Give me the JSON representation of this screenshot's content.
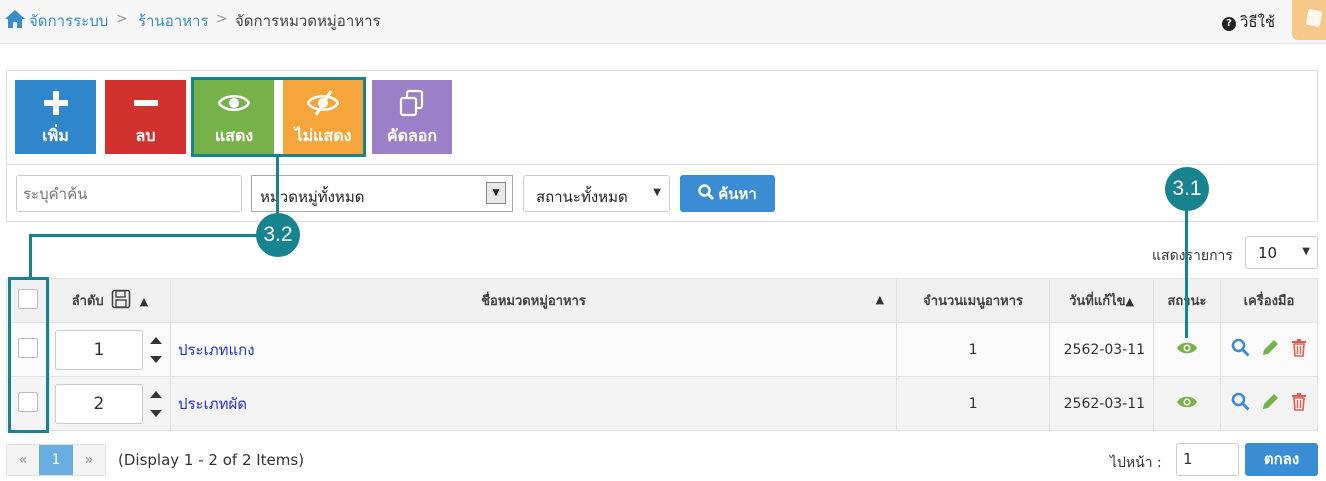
{
  "breadcrumb": {
    "items": [
      "จัดการระบบ",
      "ร้านอาหาร",
      "จัดการหมวดหมู่อาหาร"
    ],
    "separator": ">"
  },
  "help": {
    "icon": "question-icon",
    "label": "วิธีใช้"
  },
  "toolbar": {
    "add_label": "เพิ่ม",
    "delete_label": "ลบ",
    "show_label": "แสดง",
    "hide_label": "ไม่แสดง",
    "copy_label": "คัดลอก"
  },
  "filters": {
    "search_placeholder": "ระบุคำค้น",
    "category_value": "หมวดหมู่ทั้งหมด",
    "status_value": "สถานะทั้งหมด",
    "search_button": "ค้นหา"
  },
  "callouts": {
    "status": "3.1",
    "toggle": "3.2"
  },
  "per_page": {
    "label": "แสดงรายการ",
    "value": "10"
  },
  "table": {
    "headers": {
      "order": "ลำดับ",
      "name": "ชื่อหมวดหมู่อาหาร",
      "menu_count": "จำนวนเมนูอาหาร",
      "updated": "วันที่แก้ไข",
      "status": "สถานะ",
      "tools": "เครื่องมือ"
    },
    "rows": [
      {
        "order": "1",
        "name": "ประเภทแกง",
        "menu_count": "1",
        "updated": "2562-03-11",
        "status": "visible"
      },
      {
        "order": "2",
        "name": "ประเภทผัด",
        "menu_count": "1",
        "updated": "2562-03-11",
        "status": "visible"
      }
    ]
  },
  "pagination": {
    "prev": "«",
    "current": "1",
    "next": "»",
    "display_info": "(Display 1 - 2 of 2 Items)",
    "goto_label": "ไปหน้า :",
    "goto_value": "1",
    "ok_button": "ตกลง"
  },
  "colors": {
    "primary": "#2f86cb",
    "danger": "#d2322d",
    "success": "#77b14a",
    "warning": "#f5a53a",
    "purple": "#9b7fc7",
    "callout": "#17838e"
  }
}
